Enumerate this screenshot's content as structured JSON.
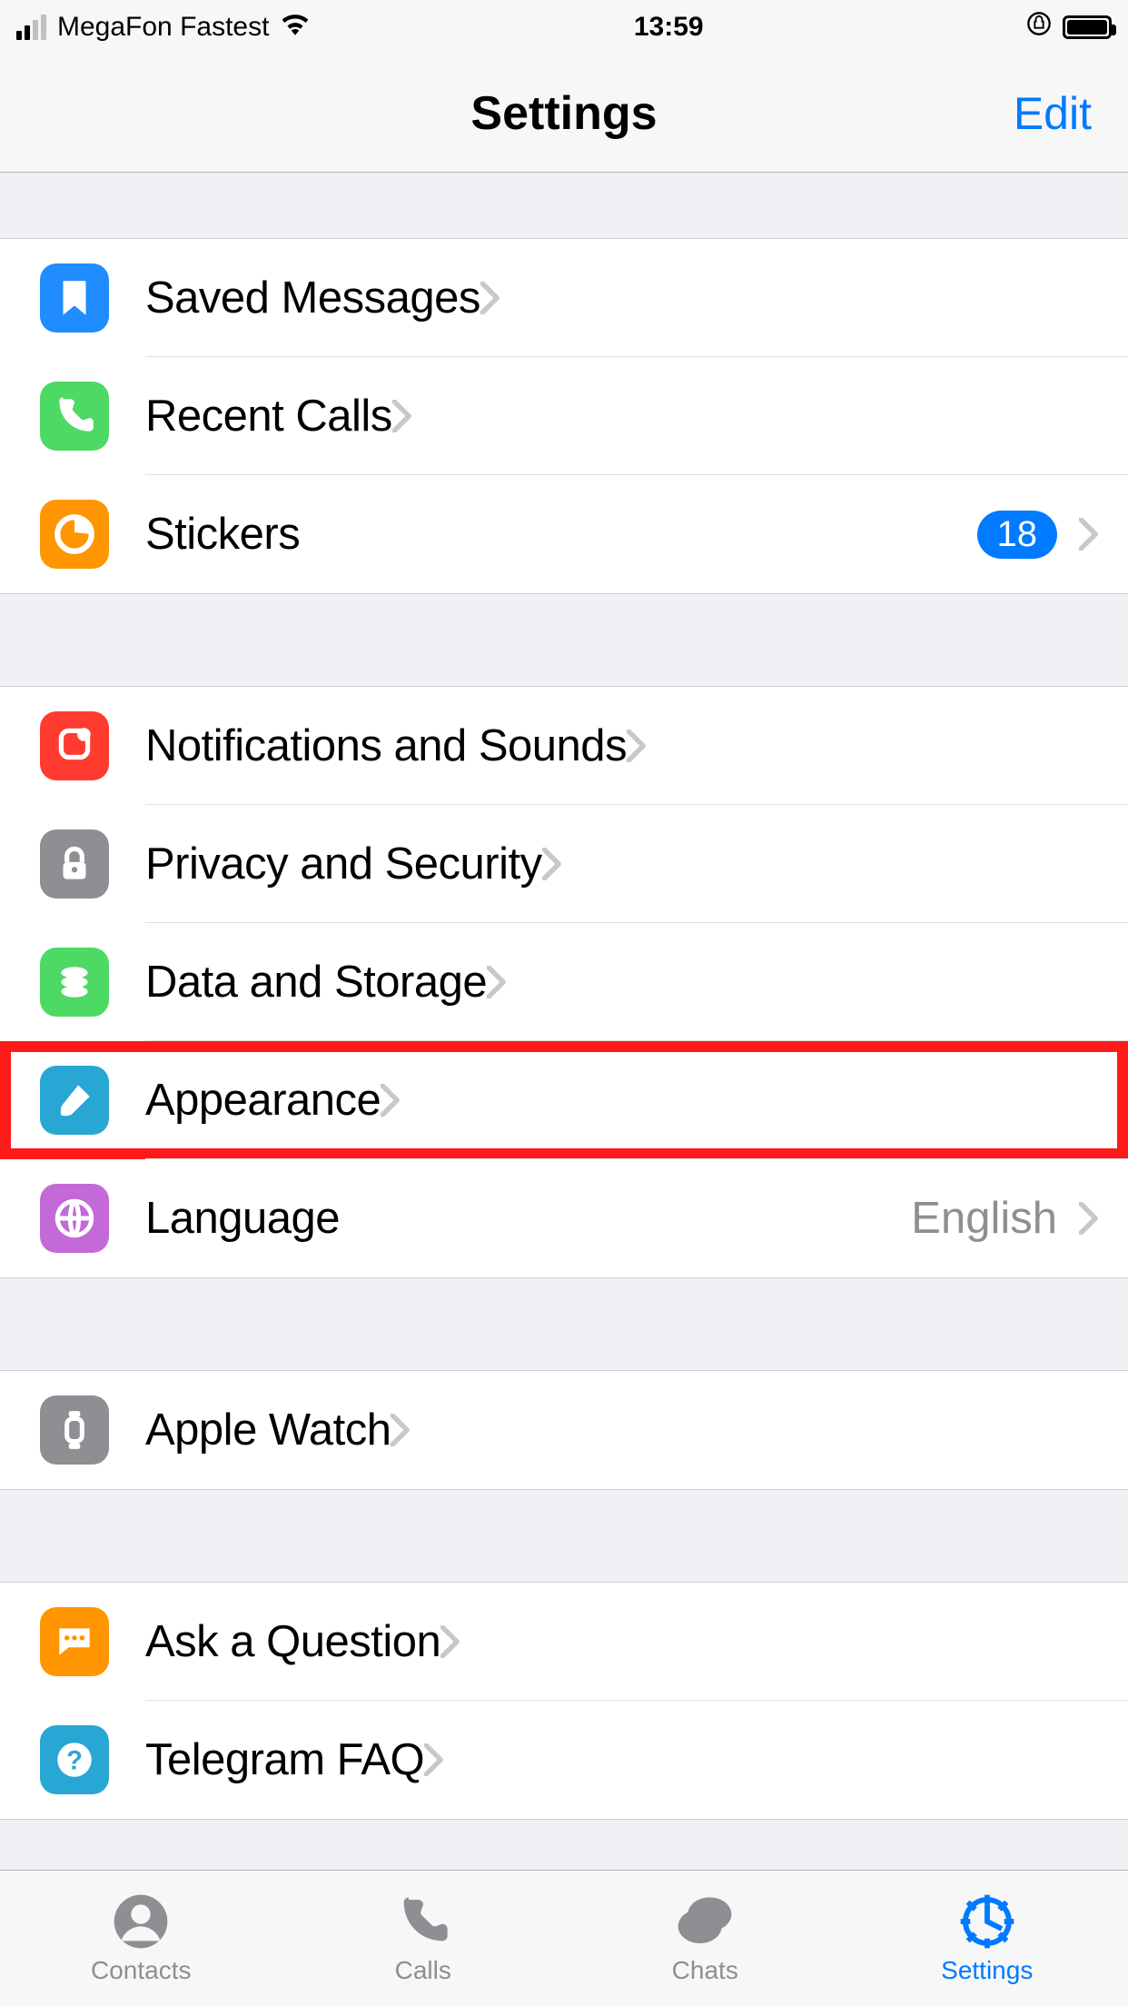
{
  "status": {
    "carrier": "MegaFon Fastest",
    "time": "13:59"
  },
  "nav": {
    "title": "Settings",
    "edit": "Edit"
  },
  "groups": [
    {
      "rows": [
        {
          "id": "saved-messages",
          "label": "Saved Messages",
          "icon": "bookmark",
          "color": "c-blue"
        },
        {
          "id": "recent-calls",
          "label": "Recent Calls",
          "icon": "phone",
          "color": "c-green"
        },
        {
          "id": "stickers",
          "label": "Stickers",
          "icon": "sticker",
          "color": "c-orange",
          "badge": "18"
        }
      ]
    },
    {
      "rows": [
        {
          "id": "notifications",
          "label": "Notifications and Sounds",
          "icon": "bell",
          "color": "c-red"
        },
        {
          "id": "privacy",
          "label": "Privacy and Security",
          "icon": "lock",
          "color": "c-gray"
        },
        {
          "id": "data-storage",
          "label": "Data and Storage",
          "icon": "storage",
          "color": "c-green"
        },
        {
          "id": "appearance",
          "label": "Appearance",
          "icon": "brush",
          "color": "c-teal",
          "highlight": true
        },
        {
          "id": "language",
          "label": "Language",
          "icon": "globe",
          "color": "c-purple",
          "detail": "English"
        }
      ]
    },
    {
      "rows": [
        {
          "id": "apple-watch",
          "label": "Apple Watch",
          "icon": "watch",
          "color": "c-gray"
        }
      ]
    },
    {
      "rows": [
        {
          "id": "ask-question",
          "label": "Ask a Question",
          "icon": "chat",
          "color": "c-orange"
        },
        {
          "id": "telegram-faq",
          "label": "Telegram FAQ",
          "icon": "help",
          "color": "c-teal"
        }
      ]
    }
  ],
  "tabs": [
    {
      "id": "contacts",
      "label": "Contacts",
      "icon": "tab-contacts"
    },
    {
      "id": "calls",
      "label": "Calls",
      "icon": "tab-calls"
    },
    {
      "id": "chats",
      "label": "Chats",
      "icon": "tab-chats"
    },
    {
      "id": "settings",
      "label": "Settings",
      "icon": "tab-settings",
      "active": true
    }
  ]
}
